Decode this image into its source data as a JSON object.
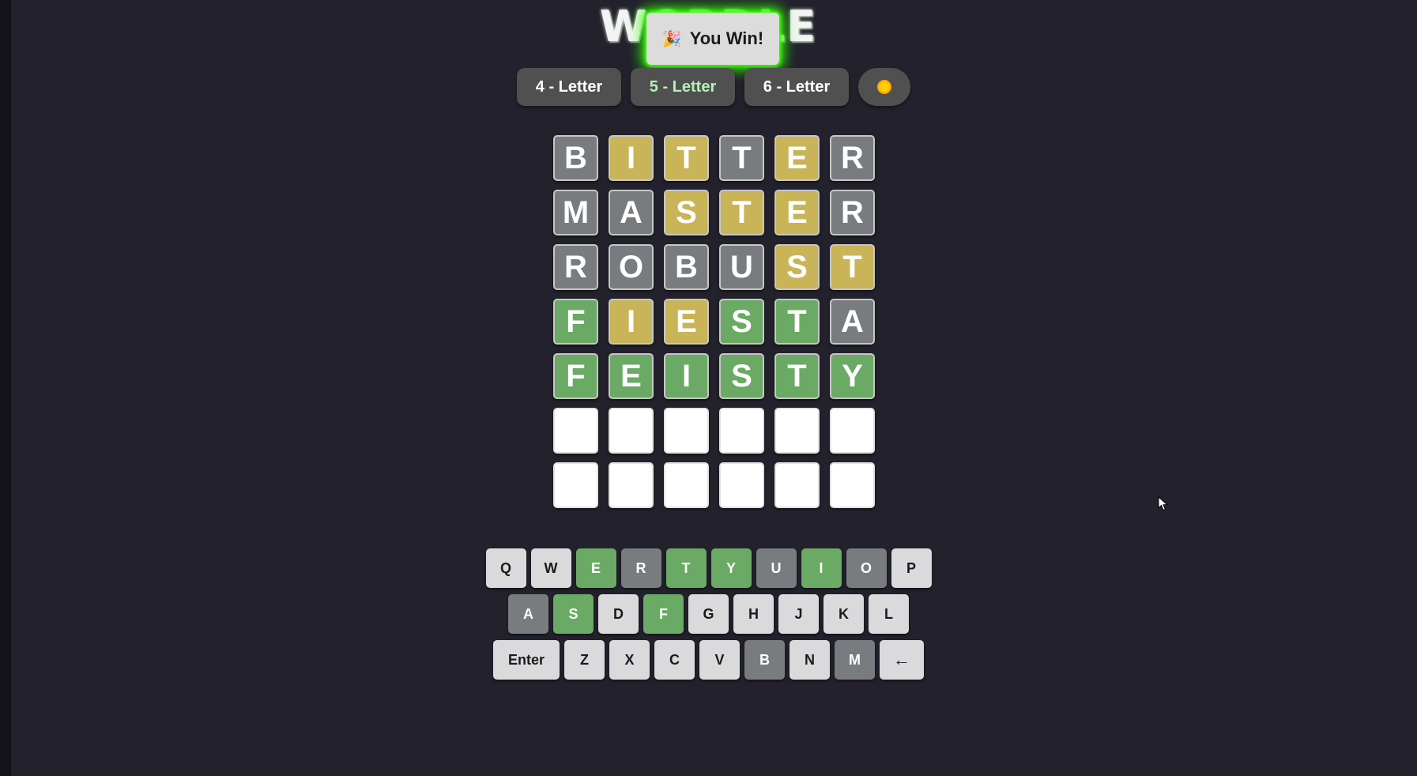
{
  "title": "WORDLE",
  "toast": {
    "icon": "🎉",
    "text": "You Win!"
  },
  "modes": [
    {
      "label": "4 - Letter",
      "active": false
    },
    {
      "label": "5 - Letter",
      "active": true
    },
    {
      "label": "6 - Letter",
      "active": false
    }
  ],
  "theme_toggle": {
    "icon": "sun-icon"
  },
  "colors": {
    "correct": "#6aaa64",
    "present": "#c9b458",
    "absent": "#787c7e",
    "empty": "#ffffff",
    "glow": "#2dff00"
  },
  "board": [
    {
      "letters": [
        "B",
        "I",
        "T",
        "T",
        "E",
        "R"
      ],
      "states": [
        "absent",
        "present",
        "present",
        "absent",
        "present",
        "absent"
      ]
    },
    {
      "letters": [
        "M",
        "A",
        "S",
        "T",
        "E",
        "R"
      ],
      "states": [
        "absent",
        "absent",
        "present",
        "present",
        "present",
        "absent"
      ]
    },
    {
      "letters": [
        "R",
        "O",
        "B",
        "U",
        "S",
        "T"
      ],
      "states": [
        "absent",
        "absent",
        "absent",
        "absent",
        "present",
        "present"
      ]
    },
    {
      "letters": [
        "F",
        "I",
        "E",
        "S",
        "T",
        "A"
      ],
      "states": [
        "correct",
        "present",
        "present",
        "correct",
        "correct",
        "absent"
      ]
    },
    {
      "letters": [
        "F",
        "E",
        "I",
        "S",
        "T",
        "Y"
      ],
      "states": [
        "correct",
        "correct",
        "correct",
        "correct",
        "correct",
        "correct"
      ]
    },
    {
      "letters": [
        "",
        "",
        "",
        "",
        "",
        ""
      ],
      "states": [
        "empty",
        "empty",
        "empty",
        "empty",
        "empty",
        "empty"
      ]
    },
    {
      "letters": [
        "",
        "",
        "",
        "",
        "",
        ""
      ],
      "states": [
        "empty",
        "empty",
        "empty",
        "empty",
        "empty",
        "empty"
      ]
    }
  ],
  "keyboard": {
    "row1": [
      {
        "label": "Q",
        "state": "unused"
      },
      {
        "label": "W",
        "state": "unused"
      },
      {
        "label": "E",
        "state": "correct"
      },
      {
        "label": "R",
        "state": "absent"
      },
      {
        "label": "T",
        "state": "correct"
      },
      {
        "label": "Y",
        "state": "correct"
      },
      {
        "label": "U",
        "state": "absent"
      },
      {
        "label": "I",
        "state": "correct"
      },
      {
        "label": "O",
        "state": "absent"
      },
      {
        "label": "P",
        "state": "unused"
      }
    ],
    "row2": [
      {
        "label": "A",
        "state": "absent"
      },
      {
        "label": "S",
        "state": "correct"
      },
      {
        "label": "D",
        "state": "unused"
      },
      {
        "label": "F",
        "state": "correct"
      },
      {
        "label": "G",
        "state": "unused"
      },
      {
        "label": "H",
        "state": "unused"
      },
      {
        "label": "J",
        "state": "unused"
      },
      {
        "label": "K",
        "state": "unused"
      },
      {
        "label": "L",
        "state": "unused"
      }
    ],
    "row3": [
      {
        "label": "Enter",
        "state": "unused"
      },
      {
        "label": "Z",
        "state": "unused"
      },
      {
        "label": "X",
        "state": "unused"
      },
      {
        "label": "C",
        "state": "unused"
      },
      {
        "label": "V",
        "state": "unused"
      },
      {
        "label": "B",
        "state": "absent"
      },
      {
        "label": "N",
        "state": "unused"
      },
      {
        "label": "M",
        "state": "absent"
      },
      {
        "label": "←",
        "state": "unused"
      }
    ]
  }
}
